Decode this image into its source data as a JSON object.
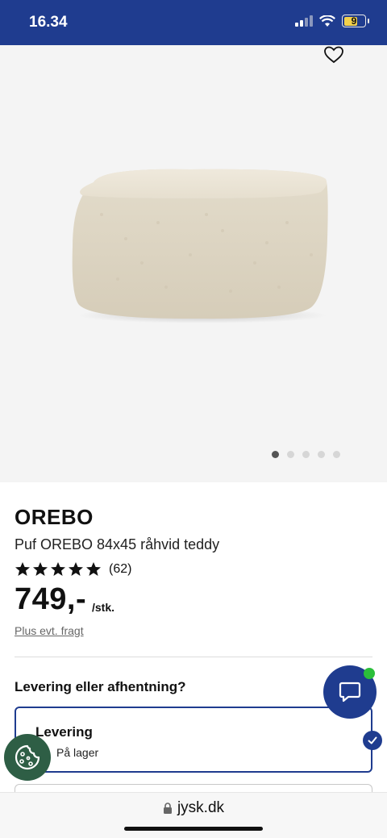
{
  "status_bar": {
    "time": "16.34",
    "battery": "9"
  },
  "product": {
    "brand": "OREBO",
    "name": "Puf OREBO 84x45 råhvid teddy",
    "rating_count": "(62)",
    "price": "749,-",
    "unit": "/stk.",
    "freight_link": "Plus evt. fragt",
    "image_count": 5,
    "active_image": 1
  },
  "delivery": {
    "question": "Levering eller afhentning?",
    "option_title": "Levering",
    "option_status": "På lager"
  },
  "browser": {
    "url": "jysk.dk"
  },
  "colors": {
    "brand_blue": "#1f3c8f",
    "online_green": "#2bbf3b",
    "cookie_green": "#2e5e45"
  }
}
